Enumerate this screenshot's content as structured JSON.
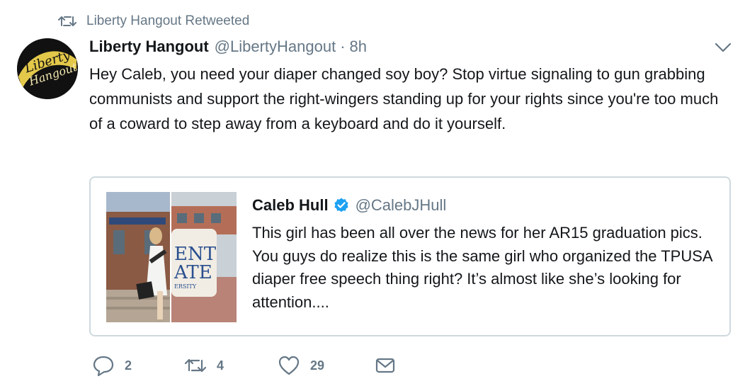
{
  "retweet": {
    "label": "Liberty Hangout Retweeted",
    "icon": "retweet-icon"
  },
  "avatar": {
    "logo_line1": "Liberty",
    "logo_line2": "Hangout",
    "colors": {
      "ring": "#111111",
      "fill": "#e3c84a",
      "text": "#111111"
    }
  },
  "tweet": {
    "name": "Liberty Hangout",
    "handle": "@LibertyHangout",
    "separator": "·",
    "time": "8h",
    "text": "Hey Caleb, you need your diaper changed soy boy? Stop virtue signaling to gun grabbing communists and support the right-wingers standing up for your rights since you're too much of a coward to step away from a keyboard and do it yourself."
  },
  "quote": {
    "name": "Caleb Hull",
    "verified_icon": "verified-badge-icon",
    "handle": "@CalebJHull",
    "text": "This girl has been all over the news for her AR15 graduation pics. You guys do realize this is the same girl who organized the TPUSA diaper free speech thing right? It’s almost like she’s looking for attention...."
  },
  "actions": {
    "reply": {
      "icon": "reply-icon",
      "count": "2"
    },
    "retweet": {
      "icon": "retweet-icon",
      "count": "4"
    },
    "like": {
      "icon": "heart-icon",
      "count": "29"
    },
    "message": {
      "icon": "envelope-icon"
    }
  },
  "colors": {
    "text": "#14171a",
    "secondary": "#657786",
    "border": "#cfd9de",
    "verified": "#1da1f2"
  }
}
